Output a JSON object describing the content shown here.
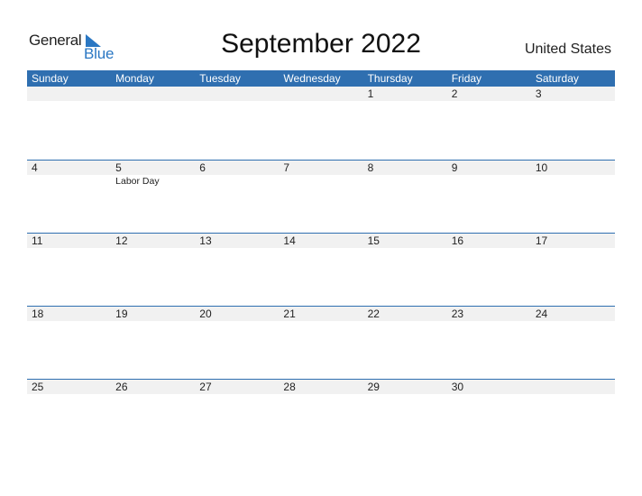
{
  "logo": {
    "line1": "General",
    "line2": "Blue",
    "icon": "triangle-flag-icon",
    "accent": "#2a77c3"
  },
  "title": "September 2022",
  "country": "United States",
  "colors": {
    "header_bg": "#2f6fb0",
    "day_row_bg": "#f1f1f1"
  },
  "weekdays": [
    "Sunday",
    "Monday",
    "Tuesday",
    "Wednesday",
    "Thursday",
    "Friday",
    "Saturday"
  ],
  "weeks": [
    {
      "days": [
        "",
        "",
        "",
        "",
        "1",
        "2",
        "3"
      ],
      "events": [
        "",
        "",
        "",
        "",
        "",
        "",
        ""
      ]
    },
    {
      "days": [
        "4",
        "5",
        "6",
        "7",
        "8",
        "9",
        "10"
      ],
      "events": [
        "",
        "Labor Day",
        "",
        "",
        "",
        "",
        ""
      ]
    },
    {
      "days": [
        "11",
        "12",
        "13",
        "14",
        "15",
        "16",
        "17"
      ],
      "events": [
        "",
        "",
        "",
        "",
        "",
        "",
        ""
      ]
    },
    {
      "days": [
        "18",
        "19",
        "20",
        "21",
        "22",
        "23",
        "24"
      ],
      "events": [
        "",
        "",
        "",
        "",
        "",
        "",
        ""
      ]
    },
    {
      "days": [
        "25",
        "26",
        "27",
        "28",
        "29",
        "30",
        ""
      ],
      "events": [
        "",
        "",
        "",
        "",
        "",
        "",
        ""
      ]
    }
  ]
}
